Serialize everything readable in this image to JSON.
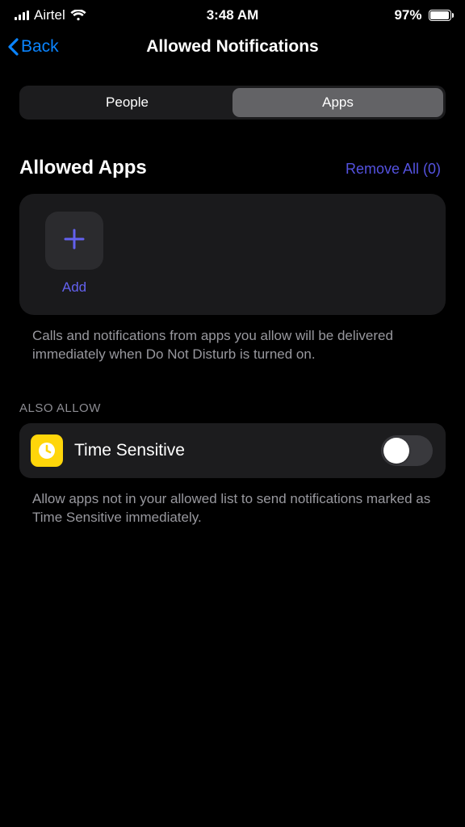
{
  "status": {
    "carrier": "Airtel",
    "time": "3:48 AM",
    "battery_pct": "97%",
    "battery_fill_pct": 97
  },
  "nav": {
    "back_label": "Back",
    "title": "Allowed Notifications"
  },
  "segments": {
    "people": "People",
    "apps": "Apps"
  },
  "allowed_apps": {
    "title": "Allowed Apps",
    "remove_all_label": "Remove All (0)",
    "add_label": "Add",
    "description": "Calls and notifications from apps you allow will be delivered immediately when Do Not Disturb is turned on."
  },
  "also_allow": {
    "header": "ALSO ALLOW",
    "time_sensitive_label": "Time Sensitive",
    "description": "Allow apps not in your allowed list to send notifications marked as Time Sensitive immediately."
  }
}
